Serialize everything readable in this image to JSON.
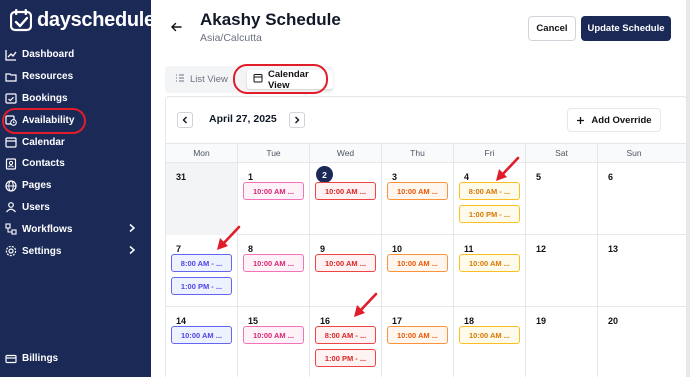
{
  "brand": {
    "name": "dayschedule"
  },
  "sidebar": {
    "items": [
      {
        "label": "Dashboard",
        "icon": "chart-icon"
      },
      {
        "label": "Resources",
        "icon": "folder-icon"
      },
      {
        "label": "Bookings",
        "icon": "calendar-check-icon"
      },
      {
        "label": "Availability",
        "icon": "clock-calendar-icon"
      },
      {
        "label": "Calendar",
        "icon": "calendar-icon"
      },
      {
        "label": "Contacts",
        "icon": "contact-icon"
      },
      {
        "label": "Pages",
        "icon": "globe-icon"
      },
      {
        "label": "Users",
        "icon": "users-icon"
      },
      {
        "label": "Workflows",
        "icon": "workflow-icon"
      },
      {
        "label": "Settings",
        "icon": "gear-icon"
      }
    ],
    "billings": "Billings"
  },
  "header": {
    "title": "Akashy Schedule",
    "timezone": "Asia/Calcutta",
    "cancel_label": "Cancel",
    "update_label": "Update Schedule"
  },
  "view_tabs": {
    "list": "List View",
    "calendar": "Calendar View"
  },
  "calendar": {
    "month_label": "April 27, 2025",
    "override_label": "Add Override",
    "weekdays": [
      "Mon",
      "Tue",
      "Wed",
      "Thu",
      "Fri",
      "Sat",
      "Sun"
    ],
    "weeks": [
      [
        {
          "day": "31",
          "muted": true,
          "events": []
        },
        {
          "day": "1",
          "events": [
            {
              "label": "10:00 AM ...",
              "color": "pink"
            }
          ]
        },
        {
          "day": "2",
          "today": true,
          "events": [
            {
              "label": "10:00 AM ...",
              "color": "red"
            }
          ]
        },
        {
          "day": "3",
          "events": [
            {
              "label": "10:00 AM ...",
              "color": "orange"
            }
          ]
        },
        {
          "day": "4",
          "events": [
            {
              "label": "8:00 AM - ...",
              "color": "yellow"
            },
            {
              "label": "1:00 PM - ...",
              "color": "yellow"
            }
          ]
        },
        {
          "day": "5",
          "events": []
        },
        {
          "day": "6",
          "events": []
        }
      ],
      [
        {
          "day": "7",
          "events": [
            {
              "label": "8:00 AM - ...",
              "color": "blue"
            },
            {
              "label": "1:00 PM - ...",
              "color": "blue"
            }
          ]
        },
        {
          "day": "8",
          "events": [
            {
              "label": "10:00 AM ...",
              "color": "pink"
            }
          ]
        },
        {
          "day": "9",
          "events": [
            {
              "label": "10:00 AM ...",
              "color": "red"
            }
          ]
        },
        {
          "day": "10",
          "events": [
            {
              "label": "10:00 AM ...",
              "color": "orange"
            }
          ]
        },
        {
          "day": "11",
          "events": [
            {
              "label": "10:00 AM ...",
              "color": "yellow"
            }
          ]
        },
        {
          "day": "12",
          "events": []
        },
        {
          "day": "13",
          "events": []
        }
      ],
      [
        {
          "day": "14",
          "events": [
            {
              "label": "10:00 AM ...",
              "color": "blue"
            }
          ]
        },
        {
          "day": "15",
          "events": [
            {
              "label": "10:00 AM ...",
              "color": "pink"
            }
          ]
        },
        {
          "day": "16",
          "events": [
            {
              "label": "8:00 AM - ...",
              "color": "red"
            },
            {
              "label": "1:00 PM - ...",
              "color": "red"
            }
          ]
        },
        {
          "day": "17",
          "events": [
            {
              "label": "10:00 AM ...",
              "color": "orange"
            }
          ]
        },
        {
          "day": "18",
          "events": [
            {
              "label": "10:00 AM ...",
              "color": "yellow"
            }
          ]
        },
        {
          "day": "19",
          "events": []
        },
        {
          "day": "20",
          "events": []
        }
      ]
    ]
  },
  "colors": {
    "sidebar_bg": "#1b2957",
    "annotation_red": "#e11d2a"
  }
}
